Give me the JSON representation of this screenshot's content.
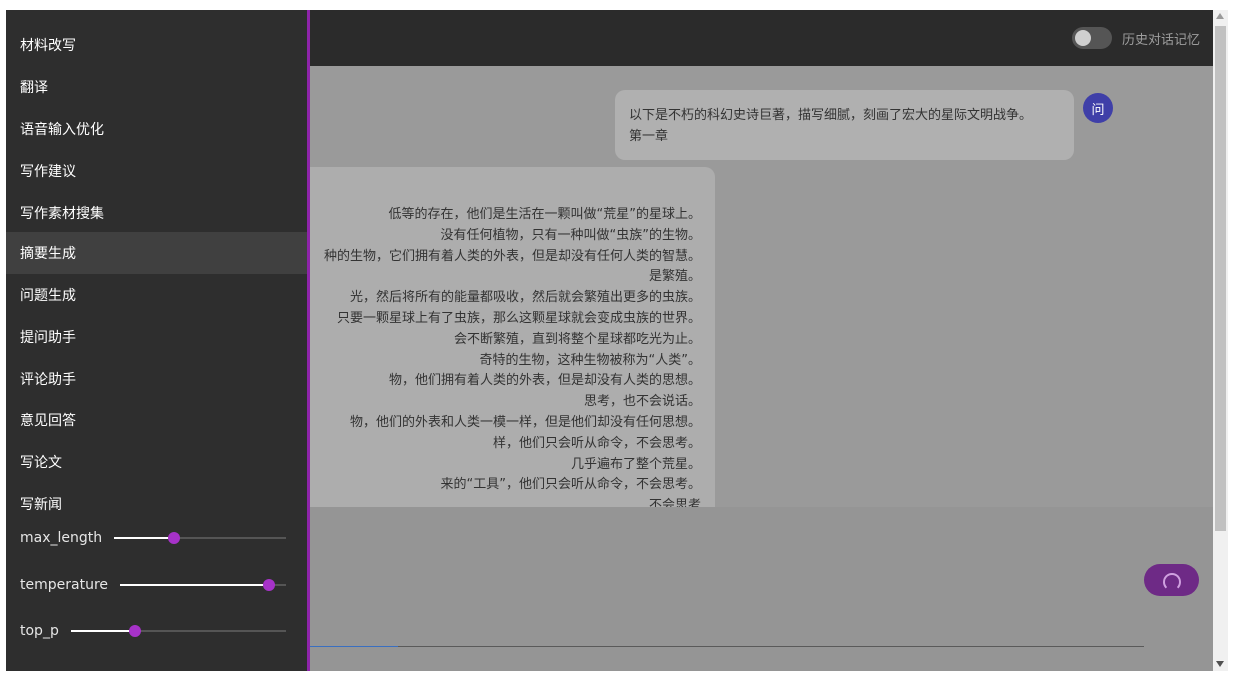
{
  "header": {
    "history_toggle_label": "历史对话记忆",
    "history_toggle_on": false
  },
  "sidebar": {
    "menu_items": [
      {
        "label": "材料改写",
        "active": false
      },
      {
        "label": "翻译",
        "active": false
      },
      {
        "label": "语音输入优化",
        "active": false
      },
      {
        "label": "写作建议",
        "active": false
      },
      {
        "label": "写作素材搜集",
        "active": false
      },
      {
        "label": "摘要生成",
        "active": true
      },
      {
        "label": "问题生成",
        "active": false
      },
      {
        "label": "提问助手",
        "active": false
      },
      {
        "label": "评论助手",
        "active": false
      },
      {
        "label": "意见回答",
        "active": false
      },
      {
        "label": "写论文",
        "active": false
      },
      {
        "label": "写新闻",
        "active": false
      }
    ],
    "sliders": [
      {
        "label": "max_length",
        "fraction": 0.35
      },
      {
        "label": "temperature",
        "fraction": 0.9
      },
      {
        "label": "top_p",
        "fraction": 0.3
      }
    ]
  },
  "chat": {
    "question": {
      "avatar": "问",
      "lines": [
        "以下是不朽的科幻史诗巨著，描写细腻，刻画了宏大的星际文明战争。",
        "第一章"
      ]
    },
    "answer_lines": [
      "低等的存在，他们是生活在一颗叫做“荒星”的星球上。",
      "没有任何植物，只有一种叫做“虫族”的生物。",
      "种的生物，它们拥有着人类的外表，但是却没有任何人类的智慧。",
      "是繁殖。",
      "光，然后将所有的能量都吸收，然后就会繁殖出更多的虫族。",
      "只要一颗星球上有了虫族，那么这颗星球就会变成虫族的世界。",
      "会不断繁殖，直到将整个星球都吃光为止。",
      "奇特的生物，这种生物被称为“人类”。",
      "物，他们拥有着人类的外表，但是却没有人类的思想。",
      "思考，也不会说话。",
      "物，他们的外表和人类一模一样，但是他们却没有任何思想。",
      "样，他们只会听从命令，不会思考。",
      "几乎遍布了整个荒星。",
      "来的“工具”，他们只会听从命令，不会思考。",
      "不会思考"
    ]
  },
  "input": {
    "send_state": "loading"
  },
  "colors": {
    "accent": "#8e24aa",
    "sidebar_bg": "#2e2e2e",
    "avatar_bg": "#3f3fa8",
    "send_button": "#6e2a86"
  }
}
